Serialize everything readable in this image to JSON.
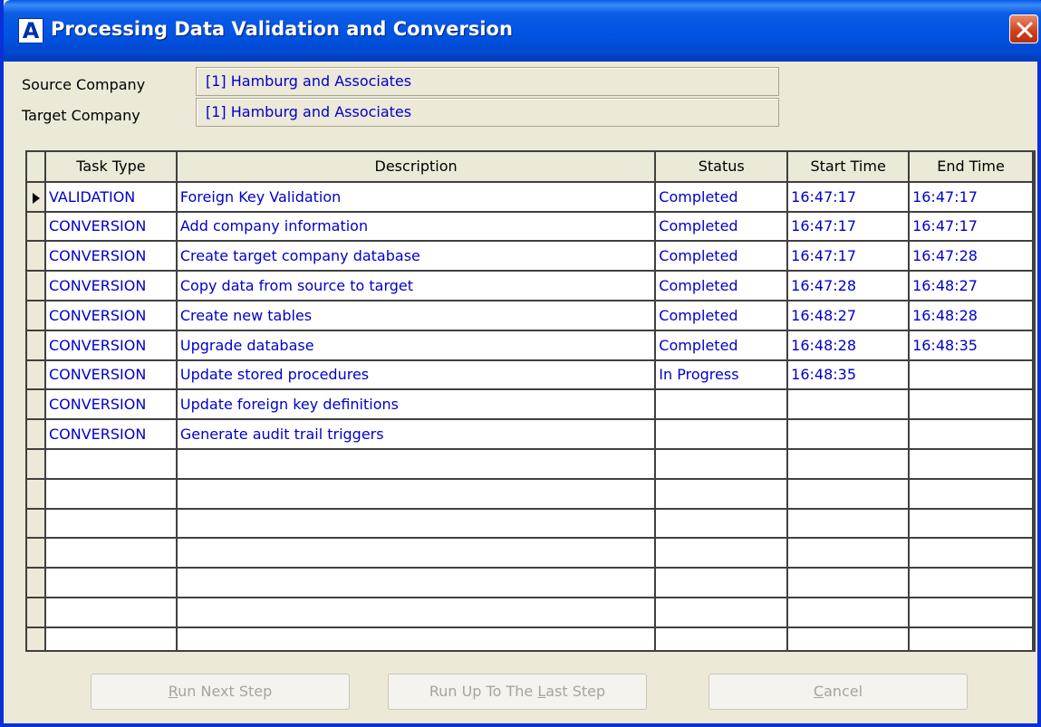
{
  "window": {
    "title": "Processing Data Validation and Conversion",
    "app_icon_letter": "A"
  },
  "form": {
    "source_label": "Source Company",
    "source_value": "[1] Hamburg and Associates",
    "target_label": "Target Company",
    "target_value": "[1] Hamburg and Associates"
  },
  "table": {
    "columns": [
      "Task Type",
      "Description",
      "Status",
      "Start Time",
      "End Time"
    ],
    "rows": [
      {
        "task_type": "VALIDATION",
        "description": "Foreign Key Validation",
        "status": "Completed",
        "start": "16:47:17",
        "end": "16:47:17",
        "current": true
      },
      {
        "task_type": "CONVERSION",
        "description": "Add company information",
        "status": "Completed",
        "start": "16:47:17",
        "end": "16:47:17"
      },
      {
        "task_type": "CONVERSION",
        "description": "Create target company database",
        "status": "Completed",
        "start": "16:47:17",
        "end": "16:47:28"
      },
      {
        "task_type": "CONVERSION",
        "description": "Copy data from source to target",
        "status": "Completed",
        "start": "16:47:28",
        "end": "16:48:27"
      },
      {
        "task_type": "CONVERSION",
        "description": "Create new tables",
        "status": "Completed",
        "start": "16:48:27",
        "end": "16:48:28"
      },
      {
        "task_type": "CONVERSION",
        "description": "Upgrade database",
        "status": "Completed",
        "start": "16:48:28",
        "end": "16:48:35"
      },
      {
        "task_type": "CONVERSION",
        "description": "Update stored procedures",
        "status": "In Progress",
        "start": "16:48:35",
        "end": ""
      },
      {
        "task_type": "CONVERSION",
        "description": "Update foreign key definitions",
        "status": "",
        "start": "",
        "end": ""
      },
      {
        "task_type": "CONVERSION",
        "description": "Generate audit trail triggers",
        "status": "",
        "start": "",
        "end": ""
      }
    ],
    "empty_rows": 7
  },
  "buttons": {
    "run_next_pre": "",
    "run_next_key": "R",
    "run_next_post": "un Next Step",
    "run_all_pre": "Run Up To The ",
    "run_all_key": "L",
    "run_all_post": "ast Step",
    "cancel_pre": "",
    "cancel_key": "C",
    "cancel_post": "ancel"
  },
  "colors": {
    "title_bar": "#0054e3",
    "window_bg": "#ece9d8",
    "data_text": "#0000cc",
    "close_button": "#d0401c",
    "disabled_text": "#a7a59a"
  },
  "icons": {
    "app": "app-logo-icon",
    "close": "close-icon",
    "current_row": "row-pointer-icon"
  }
}
